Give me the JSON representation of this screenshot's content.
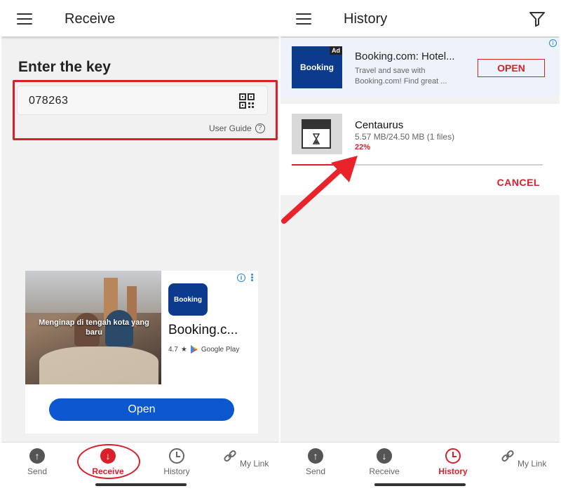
{
  "colors": {
    "accent": "#d8202a",
    "ad_blue": "#0c57d0",
    "brand_blue": "#0c3b8e"
  },
  "receive": {
    "title": "Receive",
    "heading": "Enter the key",
    "key_value": "078263",
    "user_guide": "User Guide",
    "ad": {
      "photo_caption": "Menginap di tengah kota yang baru",
      "logo_text": "Booking",
      "app_name": "Booking.c...",
      "rating": "4.7",
      "store": "Google Play",
      "open_label": "Open"
    }
  },
  "history": {
    "title": "History",
    "ad": {
      "badge": "Ad",
      "thumb_text": "Booking",
      "title": "Booking.com: Hotel...",
      "desc": "Travel and save with Booking.com! Find great ...",
      "open_label": "OPEN"
    },
    "transfer": {
      "name": "Centaurus",
      "size": "5.57 MB/24.50 MB (1 files)",
      "percent_label": "22%",
      "progress": 0.22,
      "cancel_label": "CANCEL"
    }
  },
  "nav_left": [
    {
      "label": "Send",
      "icon": "send-icon"
    },
    {
      "label": "Receive",
      "icon": "receive-icon"
    },
    {
      "label": "History",
      "icon": "history-icon"
    },
    {
      "label": "My Link",
      "icon": "link-icon"
    }
  ],
  "nav_right": [
    {
      "label": "Send",
      "icon": "send-icon"
    },
    {
      "label": "Receive",
      "icon": "receive-icon"
    },
    {
      "label": "History",
      "icon": "history-icon"
    },
    {
      "label": "My Link",
      "icon": "link-icon"
    }
  ]
}
